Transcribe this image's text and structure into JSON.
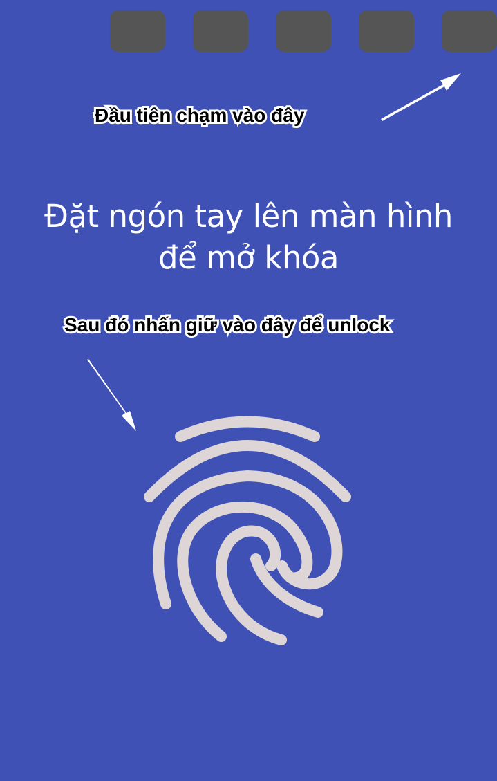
{
  "hints": {
    "first": "Đầu tiên chạm vào đây",
    "then": "Sau đó nhấn giữ vào đây để unlock"
  },
  "prompt": {
    "line1": "Đặt ngón tay lên màn hình",
    "line2": "để mở khóa"
  },
  "icons": {
    "fingerprint": "fingerprint-icon",
    "arrow": "arrow-icon"
  },
  "colors": {
    "background": "#3f51b5",
    "key": "#555555",
    "fingerprint": "#ddd5d6",
    "text": "#ffffff"
  }
}
